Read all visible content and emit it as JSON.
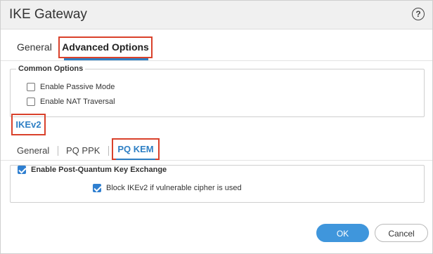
{
  "dialog": {
    "title": "IKE Gateway",
    "help_icon": "question-circle-icon",
    "help_glyph": "?"
  },
  "tabs": [
    {
      "label": "General",
      "selected": false
    },
    {
      "label": "Advanced Options",
      "selected": true
    }
  ],
  "common_options": {
    "legend": "Common Options",
    "items": [
      {
        "label": "Enable Passive Mode",
        "checked": false
      },
      {
        "label": "Enable NAT Traversal",
        "checked": false
      }
    ]
  },
  "ikev2": {
    "label": "IKEv2",
    "subtabs": [
      {
        "label": "General",
        "selected": false
      },
      {
        "label": "PQ PPK",
        "selected": false
      },
      {
        "label": "PQ KEM",
        "selected": true
      }
    ]
  },
  "pq_kem": {
    "enable_label": "Enable Post-Quantum Key Exchange",
    "enable_checked": true,
    "block_label": "Block IKEv2 if vulnerable cipher is used",
    "block_checked": true
  },
  "footer": {
    "ok_label": "OK",
    "cancel_label": "Cancel"
  },
  "colors": {
    "accent": "#2e7fc4",
    "highlight_box": "#d9412b",
    "ok_button": "#3f96dc"
  }
}
